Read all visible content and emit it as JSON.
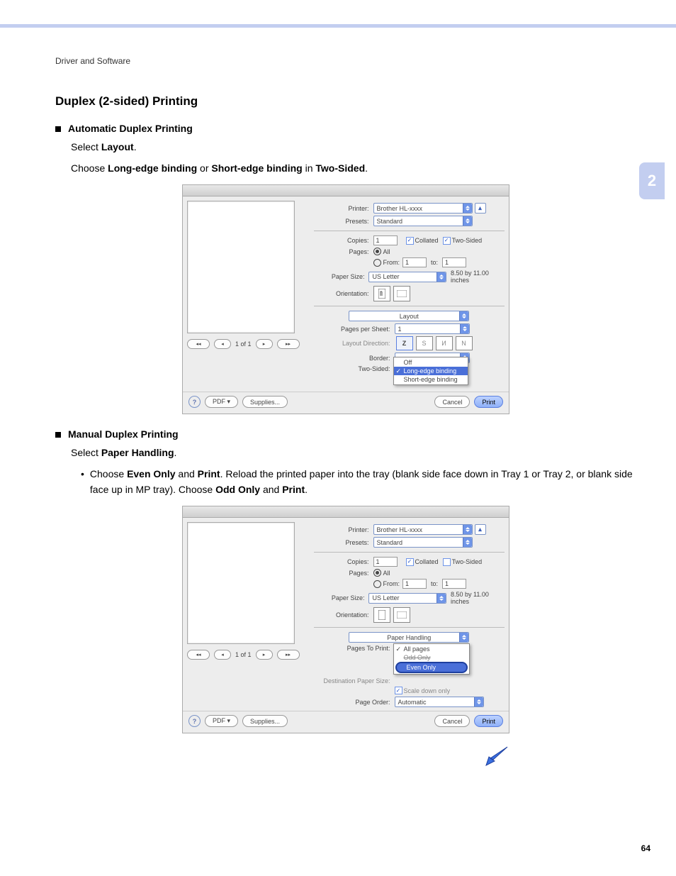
{
  "breadcrumb": "Driver and Software",
  "chapter": "2",
  "pageNumber": "64",
  "h1": "Duplex (2-sided) Printing",
  "sec1": {
    "title": "Automatic Duplex Printing",
    "line1a": "Select ",
    "line1b": "Layout",
    "line1c": ".",
    "line2a": "Choose ",
    "line2b": "Long-edge binding",
    "line2c": " or ",
    "line2d": "Short-edge binding",
    "line2e": " in ",
    "line2f": "Two-Sided",
    "line2g": "."
  },
  "sec2": {
    "title": "Manual Duplex Printing",
    "line1a": "Select ",
    "line1b": "Paper Handling",
    "line1c": ".",
    "bullet1a": "Choose ",
    "bullet1b": "Even Only",
    "bullet1c": " and ",
    "bullet1d": "Print",
    "bullet1e": ". Reload the printed paper into the tray (blank side face down in Tray 1 or Tray 2, or blank side face up in MP tray). Choose ",
    "bullet1f": "Odd Only",
    "bullet1g": " and ",
    "bullet1h": "Print",
    "bullet1i": "."
  },
  "dlg": {
    "labels": {
      "printer": "Printer:",
      "presets": "Presets:",
      "copies": "Copies:",
      "pages": "Pages:",
      "from": "From:",
      "to": "to:",
      "paperSize": "Paper Size:",
      "orientation": "Orientation:",
      "pagesPerSheet": "Pages per Sheet:",
      "layoutDirection": "Layout Direction:",
      "border": "Border:",
      "twoSided": "Two-Sided:",
      "pagesToPrint": "Pages To Print:",
      "destPaperSize": "Destination Paper Size:",
      "pageOrder": "Page Order:",
      "collated": "Collated",
      "twoSidedChk": "Two-Sided",
      "all": "All",
      "scaleDown": "Scale down only"
    },
    "values": {
      "printer": "Brother HL-xxxx",
      "presets": "Standard",
      "copies": "1",
      "from": "1",
      "to": "1",
      "paperSize": "US Letter",
      "paperDim": "8.50 by 11.00 inches",
      "layoutSection": "Layout",
      "paperHandlingSection": "Paper Handling",
      "pagesPerSheet": "1",
      "pageOrder": "Automatic",
      "preview": "1 of 1"
    },
    "twoSidedOptions": {
      "off": "Off",
      "long": "Long-edge binding",
      "short": "Short-edge binding"
    },
    "pagesToPrintOptions": {
      "all": "All pages",
      "odd": "Odd Only",
      "even": "Even Only"
    },
    "buttons": {
      "pdf": "PDF ▾",
      "supplies": "Supplies...",
      "cancel": "Cancel",
      "print": "Print"
    },
    "layoutDir": [
      "Z",
      "S",
      "И",
      "N"
    ]
  }
}
